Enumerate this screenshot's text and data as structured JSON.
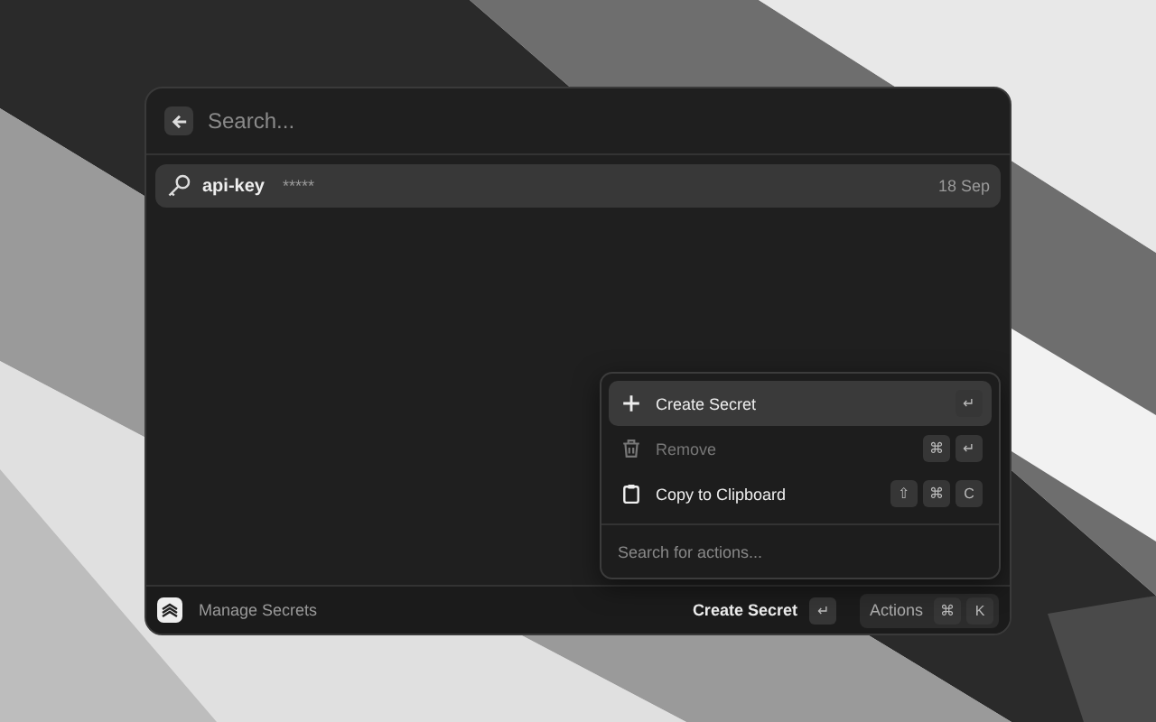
{
  "search": {
    "placeholder": "Search..."
  },
  "items": [
    {
      "title": "api-key",
      "subtitle": "*****",
      "date": "18 Sep",
      "selected": true
    }
  ],
  "actions": {
    "items": [
      {
        "kind": "plus",
        "label": "Create Secret",
        "selected": true,
        "disabled": false,
        "keys": [
          "↵"
        ]
      },
      {
        "kind": "trash",
        "label": "Remove",
        "selected": false,
        "disabled": true,
        "keys": [
          "⌘",
          "↵"
        ]
      },
      {
        "kind": "clipboard",
        "label": "Copy to Clipboard",
        "selected": false,
        "disabled": false,
        "keys": [
          "⇧",
          "⌘",
          "C"
        ]
      }
    ],
    "search": {
      "placeholder": "Search for actions..."
    }
  },
  "footer": {
    "title": "Manage Secrets",
    "primary_action": "Create Secret",
    "primary_keys": [
      "↵"
    ],
    "actions_label": "Actions",
    "actions_keys": [
      "⌘",
      "K"
    ]
  }
}
